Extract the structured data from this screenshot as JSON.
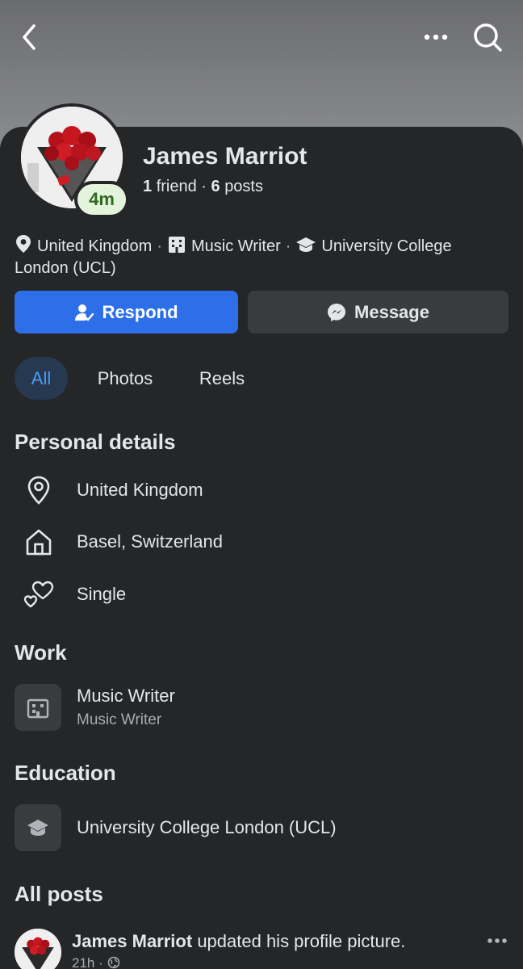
{
  "header": {
    "back_icon": "chevron-left-icon",
    "more_icon": "more-horizontal-icon",
    "search_icon": "search-icon"
  },
  "profile": {
    "name": "James Marriot",
    "badge": "4m",
    "friends_count": "1",
    "friends_label": "friend",
    "posts_count": "6",
    "posts_label": "posts"
  },
  "intro": {
    "location": "United Kingdom",
    "work": "Music Writer",
    "education": "University College London (UCL)"
  },
  "actions": {
    "respond_label": "Respond",
    "message_label": "Message"
  },
  "tabs": [
    {
      "label": "All",
      "selected": true
    },
    {
      "label": "Photos",
      "selected": false
    },
    {
      "label": "Reels",
      "selected": false
    }
  ],
  "personal_details": {
    "title": "Personal details",
    "items": [
      {
        "icon": "location-pin-icon",
        "label": "United Kingdom"
      },
      {
        "icon": "home-icon",
        "label": "Basel, Switzerland"
      },
      {
        "icon": "hearts-icon",
        "label": "Single"
      }
    ]
  },
  "work": {
    "title": "Work",
    "job_title": "Music Writer",
    "job_subtitle": "Music Writer"
  },
  "education": {
    "title": "Education",
    "school": "University College London (UCL)"
  },
  "posts": {
    "title": "All posts",
    "first": {
      "author": "James Marriot",
      "action": "updated his profile picture.",
      "time": "21h",
      "privacy_icon": "globe-icon"
    }
  },
  "colors": {
    "background": "#252628",
    "primary_blue": "#2d6fe8",
    "secondary_button": "#3a3b3d",
    "selected_tab_bg": "#263951",
    "selected_tab_text": "#4a9bf5",
    "badge_bg": "#e4f3dc",
    "badge_text": "#2e6b1e"
  }
}
